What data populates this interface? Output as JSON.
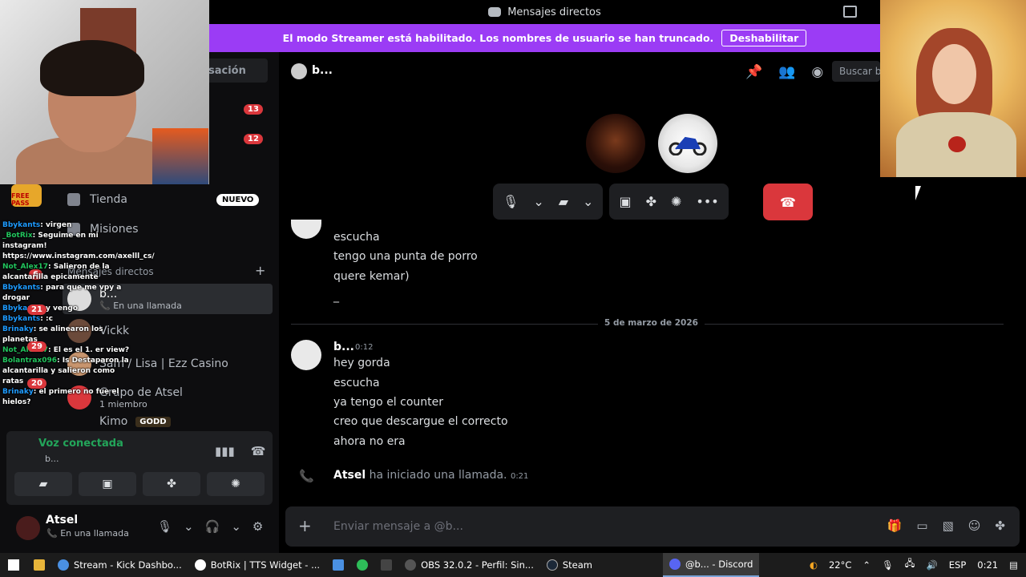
{
  "window": {
    "title": "Mensajes directos"
  },
  "banner": {
    "text": "El modo Streamer está habilitado. Los nombres de usuario se han truncado.",
    "button": "Deshabilitar"
  },
  "sidebar": {
    "conversation_search": "sación",
    "badges": [
      "13",
      "12",
      "6"
    ],
    "nav": [
      {
        "label": "Tienda",
        "badge": "NUEVO"
      },
      {
        "label": "Misiones"
      }
    ],
    "dm_header": "Mensajes directos",
    "dms": [
      {
        "name": "b...",
        "sub": "En una llamada",
        "active": true
      },
      {
        "name": "Vickk",
        "sub": ""
      },
      {
        "name": "Sam / Lisa | Ezz Casino",
        "sub": ""
      },
      {
        "name": "Grupo de Atsel",
        "sub": "1 miembro"
      }
    ],
    "partial_item": {
      "name": "Kimo",
      "tag": "GODD"
    }
  },
  "voice": {
    "status": "Voz conectada",
    "sub": "b..."
  },
  "user": {
    "name": "Atsel",
    "status": "En una llamada"
  },
  "chat_overlay": {
    "freepass": "FREE PASS",
    "messages": [
      {
        "user": "Bbykants",
        "text": ": virgen"
      },
      {
        "user": "_BotRix",
        "text": ": Seguime en mi instagram! https://www.instagram.com/axelll_cs/"
      },
      {
        "user": "Not_Alex17",
        "text": ": Salieron de la alcantarilla epicamente"
      },
      {
        "user": "Bbykants",
        "text": ": para que me vpy a drogar"
      },
      {
        "user": "Bbykants",
        "text": ": y vengo"
      },
      {
        "user": "Bbykants",
        "text": ": :c"
      },
      {
        "user": "Brinaky",
        "text": ": se alinearon los planetas"
      },
      {
        "user": "Not_Alex17",
        "text": ": El es el 1. er view?"
      },
      {
        "user": "Bolantrax096",
        "text": ": Is Destaparon la alcantarilla y salieron como ratas"
      },
      {
        "user": "Brinaky",
        "text": ": el primero no fue el hielos?"
      }
    ],
    "counts": [
      "21",
      "29",
      "20"
    ]
  },
  "main": {
    "header_name": "b...",
    "search_placeholder": "Buscar b",
    "messages_top": [
      "escucha",
      "tengo una punta de porro",
      "quere kemar)",
      "_"
    ],
    "date_divider": "5 de marzo de 2026",
    "author": "b...",
    "time": "0:12",
    "messages": [
      "hey gorda",
      "escucha",
      "ya tengo el counter",
      "creo que descargue el correcto",
      "ahora no era"
    ],
    "call_log": {
      "user": "Atsel",
      "text": "ha iniciado una llamada.",
      "time": "0:21"
    },
    "composer_placeholder": "Enviar mensaje a @b..."
  },
  "taskbar": {
    "items": [
      {
        "label": "Stream - Kick Dashbo..."
      },
      {
        "label": "BotRix | TTS Widget - ..."
      },
      {
        "label": "OBS 32.0.2 - Perfil: Sin..."
      },
      {
        "label": "Steam"
      },
      {
        "label": "@b... - Discord"
      }
    ],
    "temperature": "22°C",
    "language": "ESP",
    "time": "0:21"
  }
}
